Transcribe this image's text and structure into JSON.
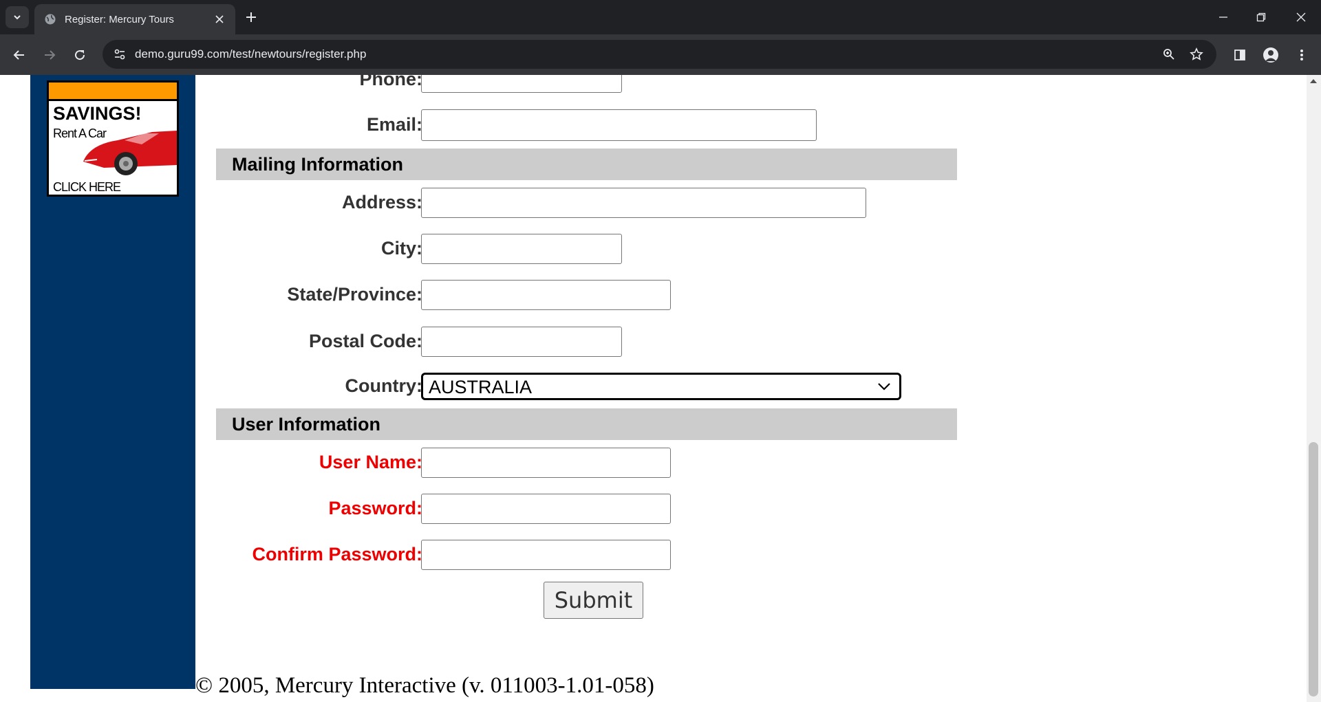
{
  "browser": {
    "tab_title": "Register: Mercury Tours",
    "url": "demo.guru99.com/test/newtours/register.php"
  },
  "ad": {
    "headline": "SAVINGS!",
    "subline": "Rent A Car",
    "cta": "CLICK HERE"
  },
  "form": {
    "phone_label": "Phone:",
    "email_label": "Email:",
    "mailing_section": "Mailing Information",
    "address_label": "Address:",
    "city_label": "City:",
    "state_label": "State/Province:",
    "postal_label": "Postal Code:",
    "country_label": "Country:",
    "country_value": "AUSTRALIA",
    "user_section": "User Information",
    "username_label": "User Name:",
    "password_label": "Password:",
    "confirm_label": "Confirm Password:",
    "submit_label": "Submit"
  },
  "footer": {
    "copyright": "© 2005, Mercury Interactive (v. 011003-1.01-058)"
  },
  "colors": {
    "sidebar": "#003366",
    "required_label": "#ee0000",
    "section_bg": "#cccccc",
    "ad_bar": "#ff9900"
  }
}
